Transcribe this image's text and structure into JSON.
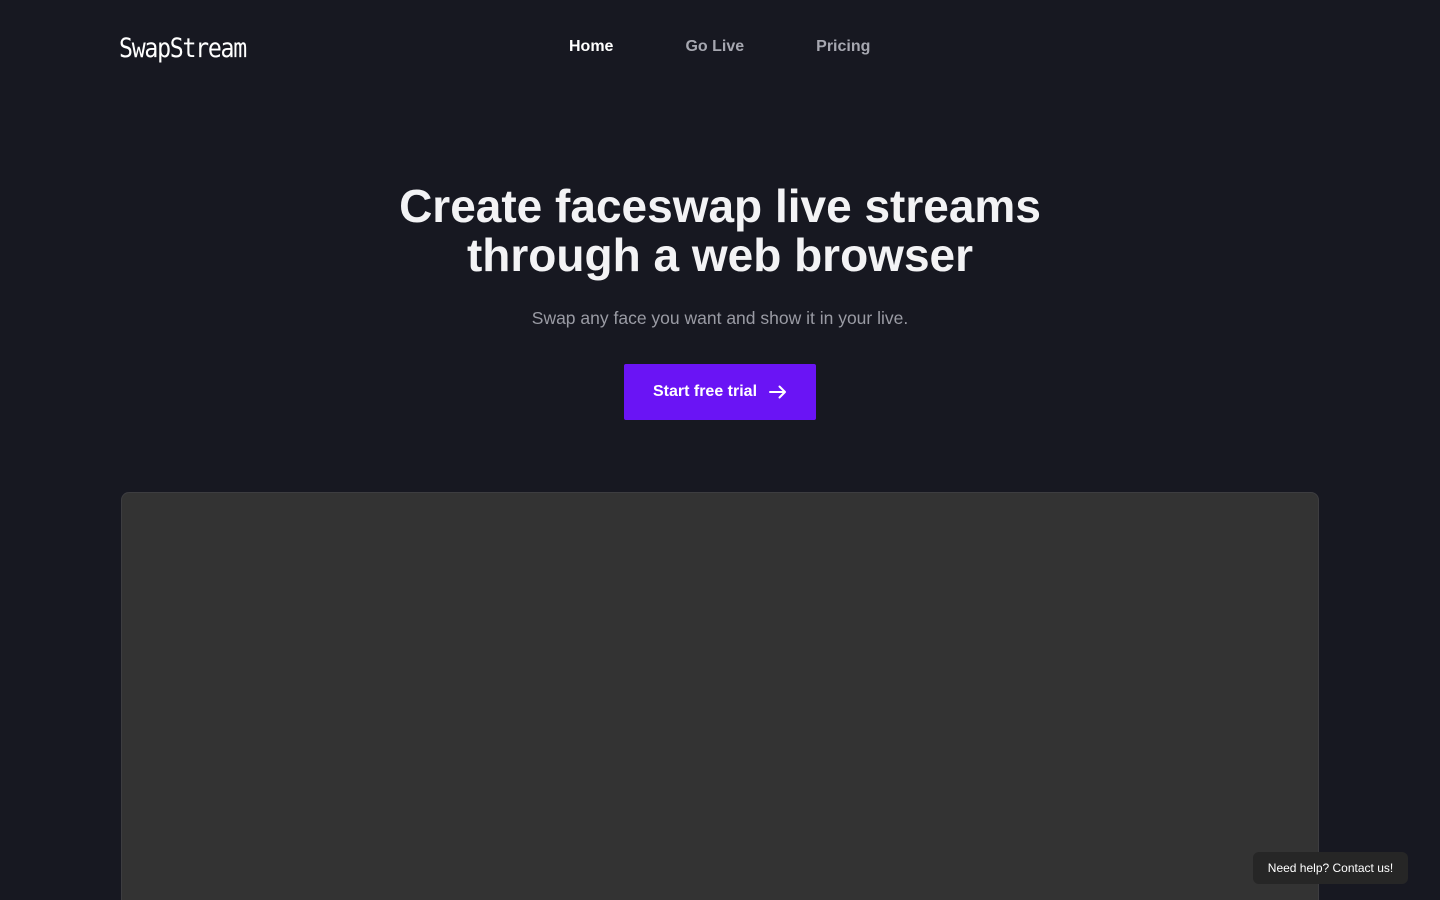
{
  "header": {
    "logo": "SwapStream",
    "nav": [
      {
        "label": "Home",
        "active": true
      },
      {
        "label": "Go Live",
        "active": false
      },
      {
        "label": "Pricing",
        "active": false
      }
    ]
  },
  "hero": {
    "title_line1": "Create faceswap live streams",
    "title_line2": "through a web browser",
    "subtitle": "Swap any face you want and show it in your live.",
    "cta_label": "Start free trial",
    "cta_icon": "arrow-right-icon"
  },
  "help_widget": {
    "label": "Need help? Contact us!"
  },
  "colors": {
    "background": "#171821",
    "accent": "#6a14f5",
    "panel": "#333333",
    "muted_text": "#9a9ba4"
  }
}
